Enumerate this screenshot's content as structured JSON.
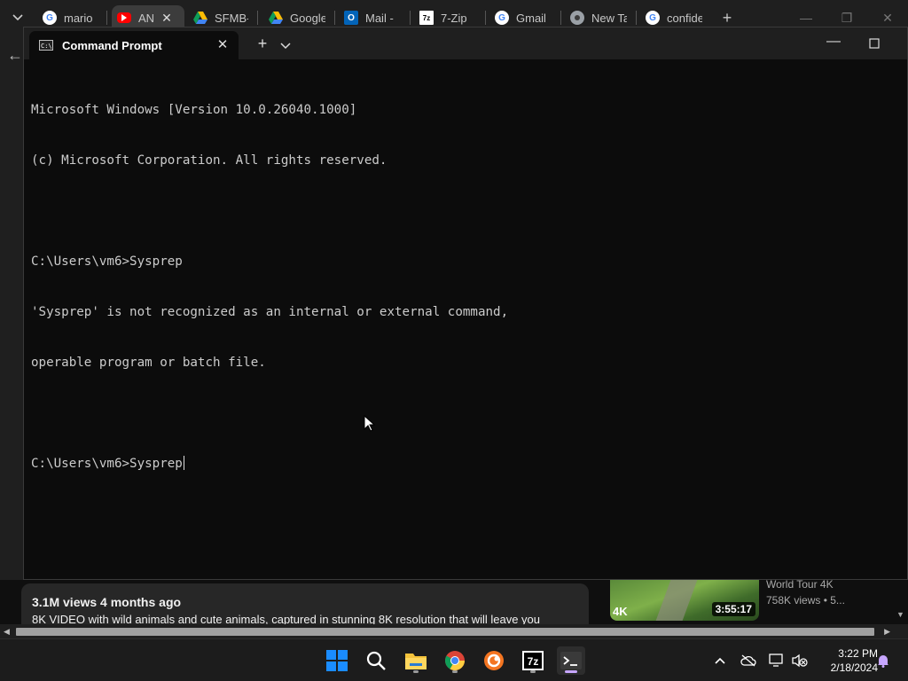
{
  "browser": {
    "tabs": [
      {
        "label": "mario",
        "icon": "google-icon"
      },
      {
        "label": "AN",
        "icon": "youtube-icon",
        "active": true
      },
      {
        "label": "SFMB-",
        "icon": "google-drive-icon"
      },
      {
        "label": "Google",
        "icon": "google-drive-icon"
      },
      {
        "label": "Mail -",
        "icon": "outlook-icon"
      },
      {
        "label": "7-Zip",
        "icon": "7zip-icon"
      },
      {
        "label": "Gmail",
        "icon": "google-icon"
      },
      {
        "label": "New Ta",
        "icon": "chrome-icon"
      },
      {
        "label": "confide",
        "icon": "google-icon"
      }
    ],
    "new_tab_symbol": "+",
    "page": {
      "stats": "3.1M views  4 months ago",
      "description": "8K VIDEO with wild animals and cute animals, captured in stunning 8K resolution that will leave you",
      "thumb_badge": "4K",
      "thumb_duration": "3:55:17",
      "side_title": "World Tour 4K",
      "side_meta": "758K views  • 5..."
    }
  },
  "terminal": {
    "tab_title": "Command Prompt",
    "icon_text": "C:\\",
    "lines": [
      "Microsoft Windows [Version 10.0.26040.1000]",
      "(c) Microsoft Corporation. All rights reserved.",
      "",
      "C:\\Users\\vm6>Sysprep",
      "'Sysprep' is not recognized as an internal or external command,",
      "operable program or batch file.",
      ""
    ],
    "current_prompt": "C:\\Users\\vm6>Sysprep"
  },
  "taskbar": {
    "apps": [
      "start",
      "search",
      "file-explorer",
      "chrome",
      "crunchyroll",
      "7zip",
      "terminal"
    ],
    "clock_time": "3:22 PM",
    "clock_date": "2/18/2024",
    "colors": {
      "accent_indicator": "#c7a6ff",
      "start_blue": "#1a8cff"
    }
  }
}
